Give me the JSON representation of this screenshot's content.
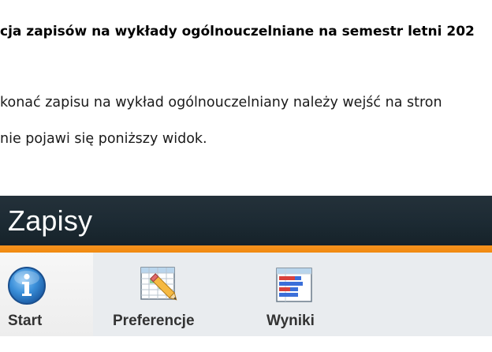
{
  "document": {
    "heading": "cja zapisów na wykłady ogólnouczelniane na semestr letni 202",
    "paragraph_line_1": "konać zapisu na wykład ogólnouczelniany należy wejść na stron",
    "paragraph_line_2": "nie pojawi się poniższy widok."
  },
  "app": {
    "title": "Zapisy",
    "colors": {
      "header": "#1c2a33",
      "accent": "#f7931e",
      "nav_background": "#e9ecef"
    },
    "nav": {
      "items": [
        {
          "label": "Start",
          "icon": "info-icon",
          "active": true
        },
        {
          "label": "Preferencje",
          "icon": "edit-grid-icon",
          "active": false
        },
        {
          "label": "Wyniki",
          "icon": "results-chart-icon",
          "active": false
        }
      ]
    }
  }
}
